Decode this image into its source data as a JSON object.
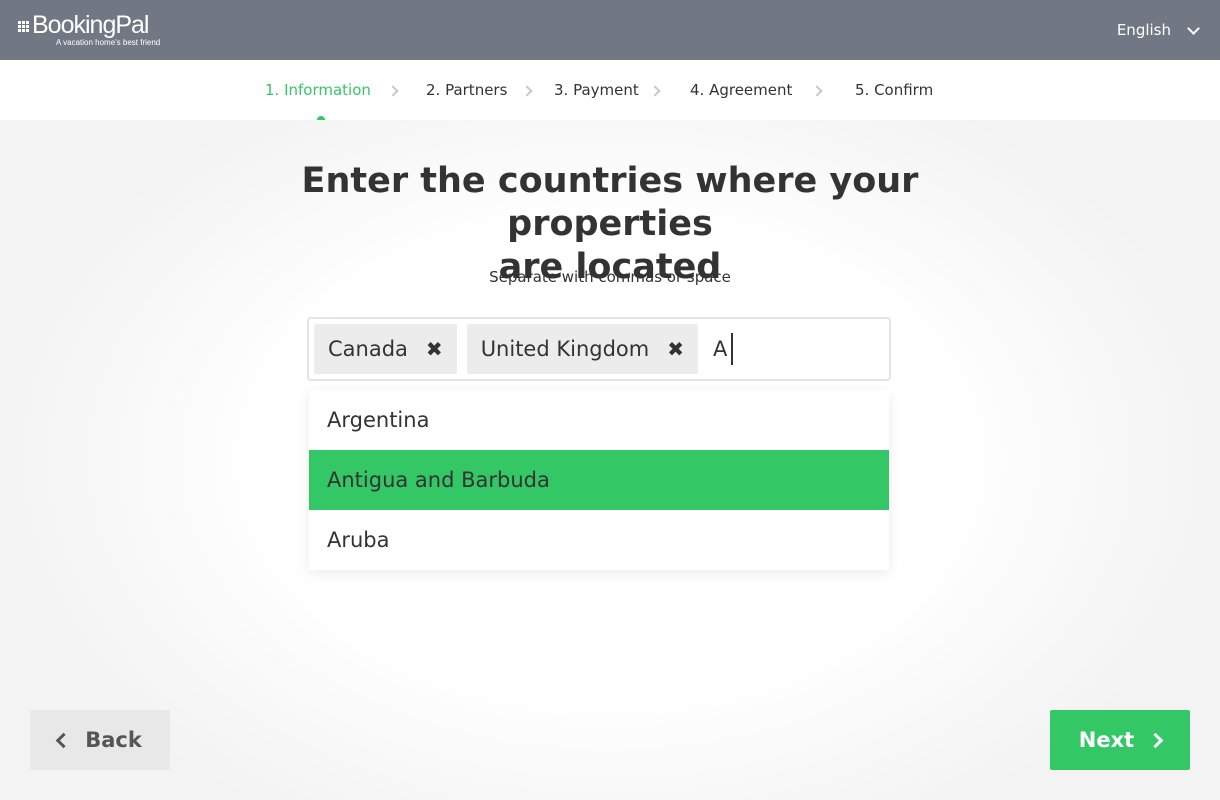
{
  "header": {
    "brand_name": "BookingPal",
    "brand_tagline": "A vacation home's best friend",
    "language": "English",
    "bar_color": "#727784"
  },
  "steps": [
    {
      "label": "1. Information",
      "active": true
    },
    {
      "label": "2. Partners",
      "active": false
    },
    {
      "label": "3. Payment",
      "active": false
    },
    {
      "label": "4. Agreement",
      "active": false
    },
    {
      "label": "5. Confirm",
      "active": false
    }
  ],
  "main": {
    "title_line1": "Enter the countries where your properties",
    "title_line2": "are located",
    "subtitle": "Separate with commas or space"
  },
  "input": {
    "tags": [
      {
        "label": "Canada"
      },
      {
        "label": "United Kingdom"
      }
    ],
    "typed_value": "A"
  },
  "dropdown": {
    "options": [
      {
        "label": "Argentina",
        "highlighted": false
      },
      {
        "label": "Antigua and Barbuda",
        "highlighted": true
      },
      {
        "label": "Aruba",
        "highlighted": false
      }
    ]
  },
  "footer": {
    "back_label": "Back",
    "next_label": "Next"
  },
  "colors": {
    "accent": "#34c765",
    "text": "#333333"
  }
}
